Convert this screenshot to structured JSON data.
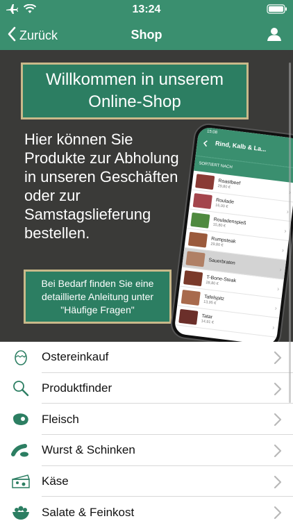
{
  "status_bar": {
    "time": "13:24",
    "icons": [
      "airplane-icon",
      "wifi-icon",
      "battery-icon"
    ]
  },
  "nav": {
    "back_label": "Zurück",
    "title": "Shop",
    "user_icon": "user-icon"
  },
  "banner": {
    "welcome": "Willkommen in unserem Online-Shop",
    "intro": "Hier können Sie Produkte zur Abholung in unseren Geschäften oder zur Samstagslieferung bestellen.",
    "hint": "Bei Bedarf finden Sie eine detaillierte Anleitung unter \"Häufige Fragen\""
  },
  "phone_preview": {
    "time": "15:08",
    "title": "Rind, Kalb & La...",
    "sort_label": "SORTIERT NACH",
    "products": [
      {
        "name": "Roastbeef",
        "price": "29,80 €"
      },
      {
        "name": "Roulade",
        "price": "16,00 €"
      },
      {
        "name": "Rouladenspieß",
        "price": "15,80 €"
      },
      {
        "name": "Rumpsteak",
        "price": "29,80 €"
      },
      {
        "name": "Sauerbraten",
        "price": ""
      },
      {
        "name": "T-Bone-Steak",
        "price": "28,80 €"
      },
      {
        "name": "Tafelspitz",
        "price": "13,95 €"
      },
      {
        "name": "Tatar",
        "price": "14,91 €"
      }
    ]
  },
  "menu": [
    {
      "label": "Ostereinkauf",
      "icon": "easter-egg-icon"
    },
    {
      "label": "Produktfinder",
      "icon": "magnifier-icon"
    },
    {
      "label": "Fleisch",
      "icon": "steak-icon"
    },
    {
      "label": "Wurst & Schinken",
      "icon": "sausage-icon"
    },
    {
      "label": "Käse",
      "icon": "cheese-icon"
    },
    {
      "label": "Salate & Feinkost",
      "icon": "salad-bowl-icon"
    }
  ],
  "colors": {
    "primary": "#3a8f6f",
    "banner_bg": "#3a3a38",
    "box_green": "#2c7e62",
    "box_border": "#c9b98a"
  }
}
